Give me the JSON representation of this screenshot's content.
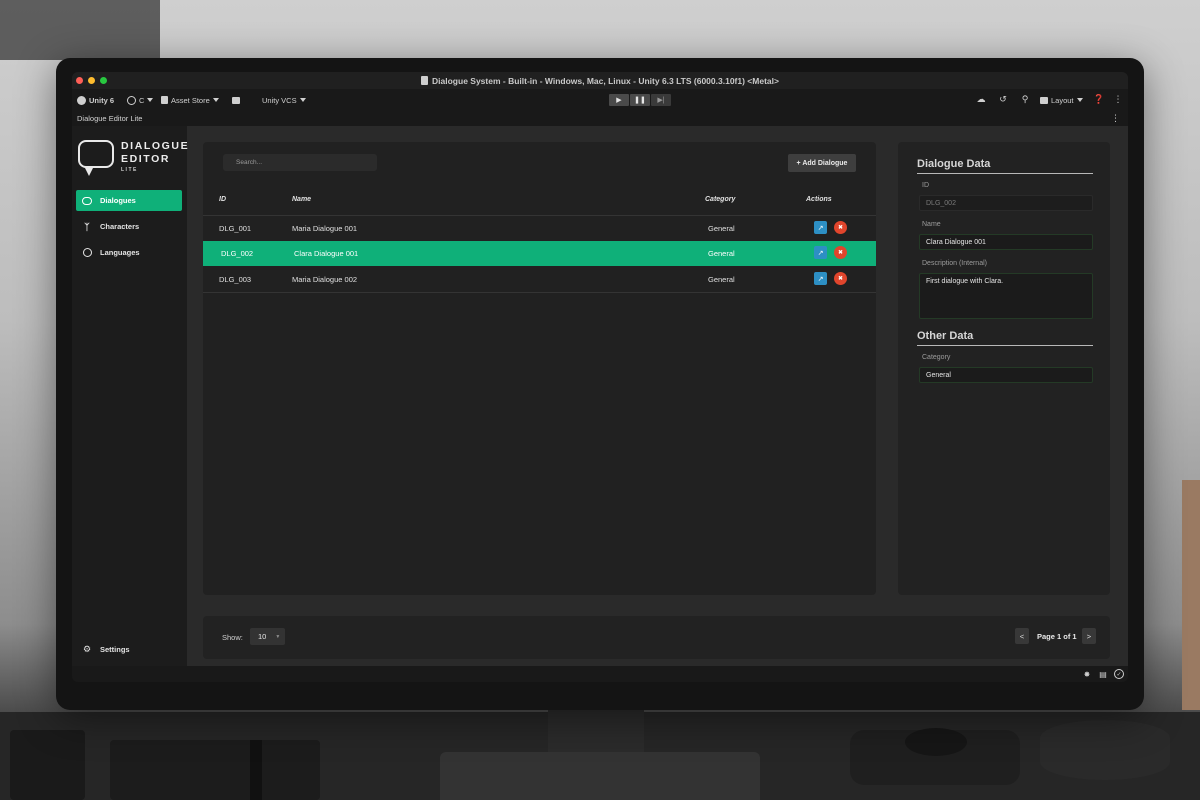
{
  "window": {
    "title": "Dialogue System - Built-in - Windows, Mac, Linux - Unity 6.3 LTS (6000.3.10f1) <Metal>"
  },
  "toolbar": {
    "unity_version": "Unity 6",
    "account_label": "C",
    "asset_store_label": "Asset Store",
    "vcs_label": "Unity VCS",
    "layout_label": "Layout"
  },
  "editor_window": {
    "tab_label": "Dialogue Editor Lite"
  },
  "logo": {
    "line1": "DIALOGUE",
    "line2": "EDITOR",
    "line3": "LITE"
  },
  "sidebar": {
    "items": [
      {
        "label": "Dialogues",
        "icon": "chat-bubble-icon",
        "active": true
      },
      {
        "label": "Characters",
        "icon": "characters-icon",
        "active": false
      },
      {
        "label": "Languages",
        "icon": "globe-icon",
        "active": false
      }
    ],
    "settings_label": "Settings",
    "accent_color": "#0fb079"
  },
  "list": {
    "search_placeholder": "Search...",
    "add_button_label": "+ Add Dialogue",
    "columns": {
      "id": "ID",
      "name": "Name",
      "category": "Category",
      "actions": "Actions"
    },
    "rows": [
      {
        "id": "DLG_001",
        "name": "Maria Dialogue 001",
        "category": "General",
        "selected": false
      },
      {
        "id": "DLG_002",
        "name": "Clara Dialogue 001",
        "category": "General",
        "selected": true
      },
      {
        "id": "DLG_003",
        "name": "Maria Dialogue 002",
        "category": "General",
        "selected": false
      }
    ]
  },
  "pagination": {
    "show_label": "Show:",
    "page_size": "10",
    "prev_label": "<",
    "page_label": "Page 1 of 1",
    "next_label": ">"
  },
  "details": {
    "dialogue_data_title": "Dialogue Data",
    "id_label": "ID",
    "id_value": "DLG_002",
    "name_label": "Name",
    "name_value": "Clara Dialogue 001",
    "description_label": "Description (Internal)",
    "description_value": "First dialogue with Clara.",
    "other_data_title": "Other Data",
    "category_label": "Category",
    "category_value": "General"
  }
}
